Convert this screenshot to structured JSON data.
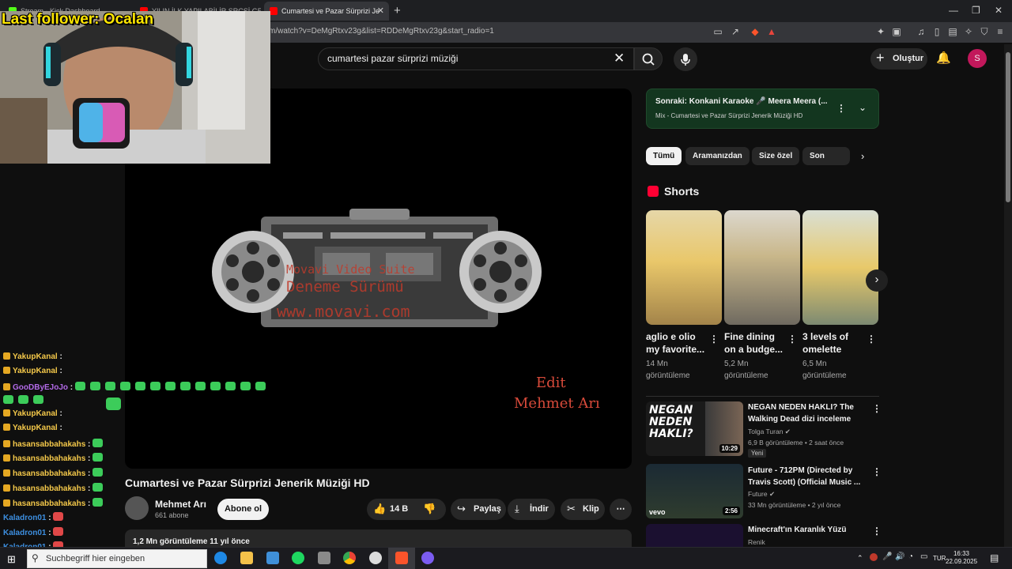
{
  "browser": {
    "tabs": [
      {
        "label": "Stream - Kick Dashboard"
      },
      {
        "label": "YILIN İLK YAPILABİLİR SRCSİ GELDİ!..."
      },
      {
        "label": "Cumartesi ve Pazar Sürprizi Je"
      }
    ],
    "url": "m/watch?v=DeMgRtxv23g&list=RDDeMgRtxv23g&start_radio=1"
  },
  "overlay": {
    "last_follower": "Last follower: Ocalan"
  },
  "search": {
    "query": "cumartesi pazar sürprizi müziği"
  },
  "header": {
    "create_label": "Oluştur",
    "avatar_letter": "S"
  },
  "video": {
    "watermark": [
      "Movavi Video Suite",
      "Deneme Sürümü",
      "www.movavi.com"
    ],
    "edit_line1": "Edit",
    "edit_line2": "Mehmet Arı",
    "title": "Cumartesi ve Pazar Sürprizi Jenerik Müziği HD",
    "channel": "Mehmet Arı",
    "subscribers": "661 abone",
    "subscribe_label": "Abone ol",
    "likes": "14 B",
    "share_label": "Paylaş",
    "download_label": "İndir",
    "clip_label": "Klip",
    "description_stats": "1,2 Mn görüntüleme  11 yıl önce"
  },
  "upnext": {
    "title": "Sonraki: Konkani Karaoke 🎤 Meera Meera (...",
    "subtitle": "Mix - Cumartesi ve Pazar Sürprizi Jenerik Müziği HD"
  },
  "chips": [
    "Tümü",
    "Aramanızdan",
    "Size özel",
    "Son yükle"
  ],
  "shorts": {
    "heading": "Shorts",
    "items": [
      {
        "title": "aglio e olio my favorite...",
        "views": "14 Mn görüntüleme"
      },
      {
        "title": "Fine dining on a budge...",
        "views": "5,2 Mn görüntüleme"
      },
      {
        "title": "3 levels of omelette",
        "views": "6,5 Mn görüntüleme"
      }
    ]
  },
  "related": [
    {
      "title": "NEGAN NEDEN HAKLI? The Walking Dead dizi inceleme",
      "channel": "Tolga Turan",
      "meta": "6,9 B görüntüleme • 2 saat önce",
      "badge": "Yeni",
      "duration": "10:29",
      "thumb_text": "NEGAN NEDEN HAKLI?"
    },
    {
      "title": "Future - 712PM (Directed by Travis Scott) (Official Music ...",
      "channel": "Future",
      "meta": "33 Mn görüntüleme • 2 yıl önce",
      "duration": "2:56",
      "thumb_text": "vevo"
    },
    {
      "title": "Minecraft'ın Karanlık Yüzü",
      "channel": "Renik"
    }
  ],
  "chat": [
    {
      "user": "YakupKanal",
      "color": "#f5c94a"
    },
    {
      "user": "YakupKanal",
      "color": "#f5c94a"
    },
    {
      "user": "GooDByEJoJo",
      "color": "#b36ae8"
    },
    {
      "user": "YakupKanal",
      "color": "#f5c94a"
    },
    {
      "user": "YakupKanal",
      "color": "#f5c94a"
    },
    {
      "user": "hasansabbahakahs",
      "color": "#f5c94a"
    },
    {
      "user": "hasansabbahakahs",
      "color": "#f5c94a"
    },
    {
      "user": "hasansabbahakahs",
      "color": "#f5c94a"
    },
    {
      "user": "hasansabbahakahs",
      "color": "#f5c94a"
    },
    {
      "user": "hasansabbahakahs",
      "color": "#f5c94a"
    },
    {
      "user": "Kaladron01",
      "color": "#3d8fe0"
    },
    {
      "user": "Kaladron01",
      "color": "#3d8fe0"
    },
    {
      "user": "Kaladron01",
      "color": "#3d8fe0"
    }
  ],
  "taskbar": {
    "search_placeholder": "Suchbegriff hier eingeben",
    "lang": "TUR",
    "time": "16:33",
    "date": "22.09.2025"
  }
}
